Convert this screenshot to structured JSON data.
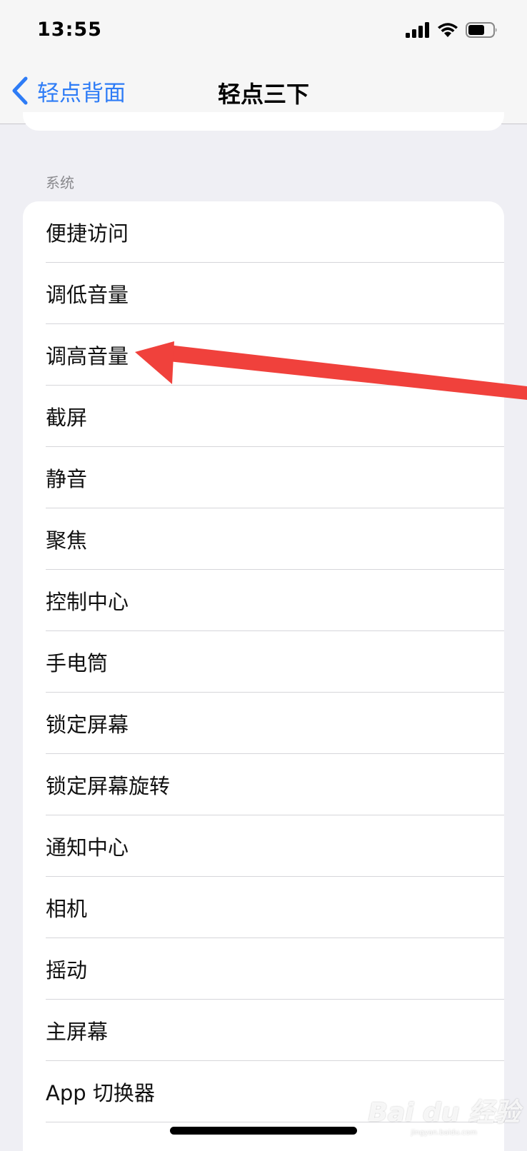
{
  "status_bar": {
    "time": "13:55"
  },
  "nav": {
    "back_label": "轻点背面",
    "title": "轻点三下"
  },
  "section": {
    "header": "系统"
  },
  "list_items": [
    "便捷访问",
    "调低音量",
    "调高音量",
    "截屏",
    "静音",
    "聚焦",
    "控制中心",
    "手电筒",
    "锁定屏幕",
    "锁定屏幕旋转",
    "通知中心",
    "相机",
    "摇动",
    "主屏幕",
    "App 切换器"
  ],
  "annotation": {
    "color": "#f0413c",
    "target_item": "调高音量"
  },
  "watermark": {
    "text": "Bai du 经验",
    "sub": "jingyan.baidu.com"
  },
  "colors": {
    "accent": "#2e7cf6",
    "background": "#efeff4"
  }
}
